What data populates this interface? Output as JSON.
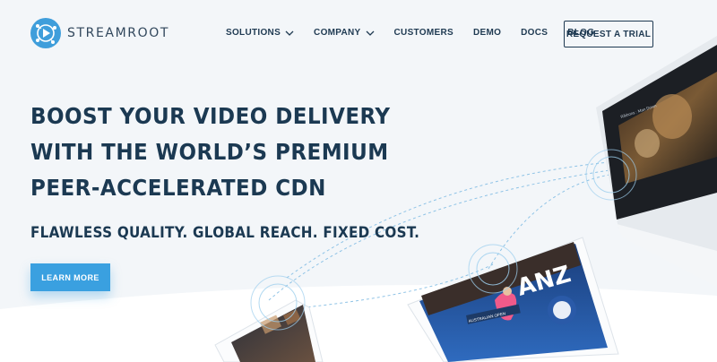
{
  "brand": {
    "name": "STREAMROOT",
    "accent": "#3aa0e0",
    "dark": "#1b3952"
  },
  "nav": {
    "items": [
      {
        "label": "SOLUTIONS",
        "has_dropdown": true
      },
      {
        "label": "COMPANY",
        "has_dropdown": true
      },
      {
        "label": "CUSTOMERS",
        "has_dropdown": false
      },
      {
        "label": "DEMO",
        "has_dropdown": false
      },
      {
        "label": "DOCS",
        "has_dropdown": false
      },
      {
        "label": "BLOG",
        "has_dropdown": false
      }
    ],
    "cta": "REQUEST A TRIAL"
  },
  "hero": {
    "headline": [
      "BOOST YOUR VIDEO DELIVERY",
      "WITH THE WORLD’S PREMIUM",
      "PEER-ACCELERATED CDN"
    ],
    "subhead": "FLAWLESS QUALITY. GLOBAL REACH. FIXED COST.",
    "button": "LEARN MORE"
  },
  "devices": {
    "laptop_title": "Ribbons : Man Down",
    "tablet_caption": "AUSTRALIAN OPEN"
  }
}
